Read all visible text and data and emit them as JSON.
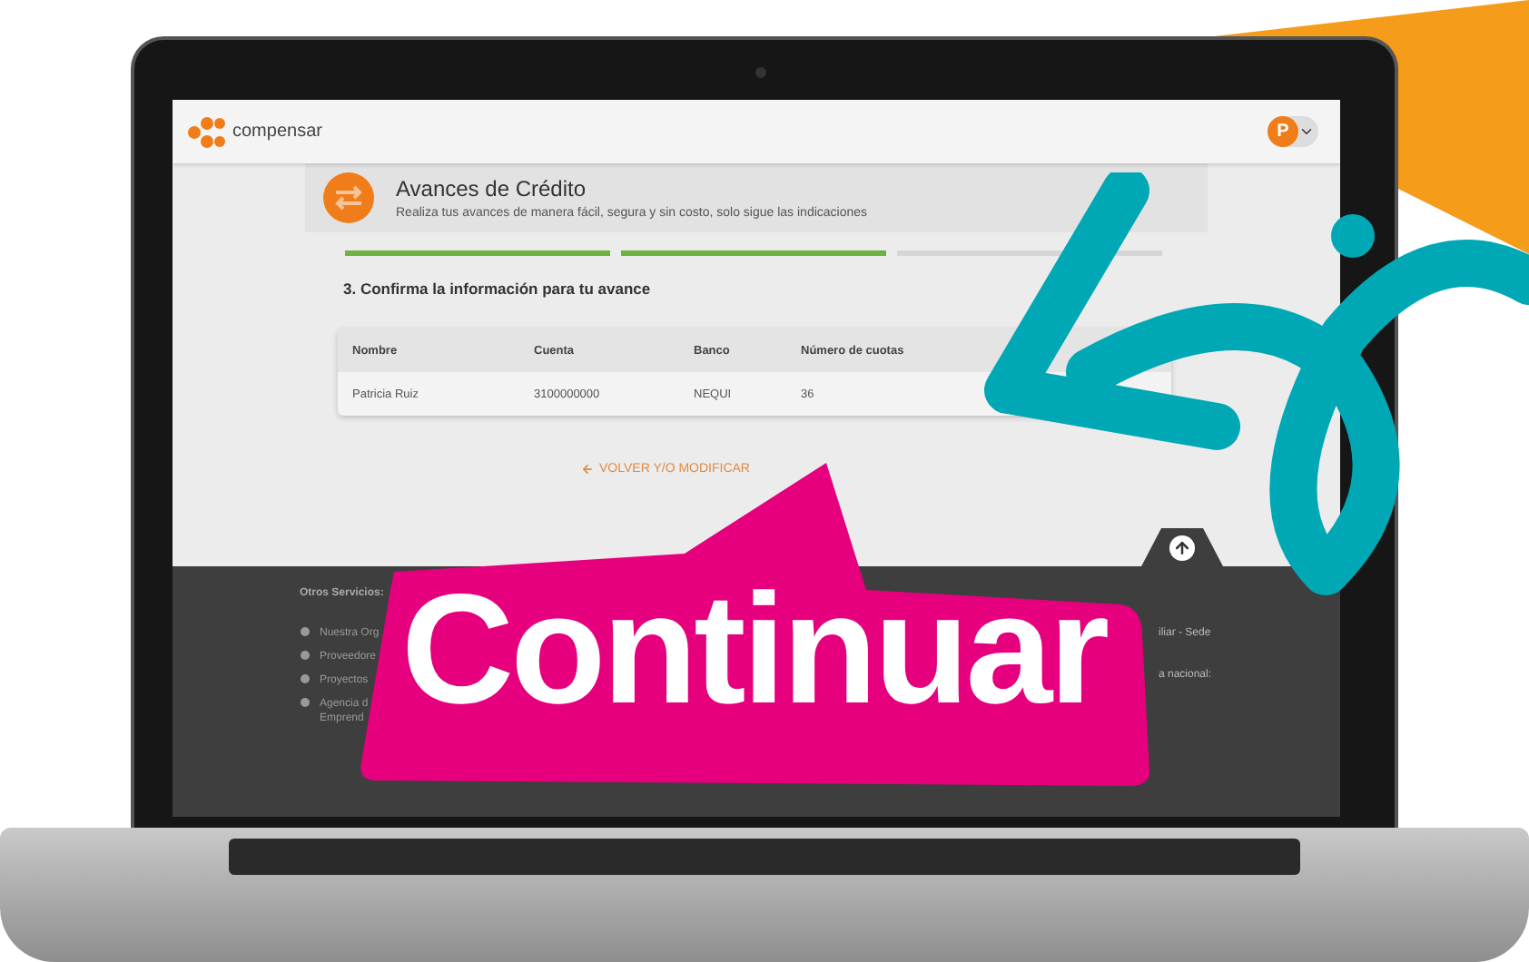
{
  "header": {
    "logo": "compensar",
    "avatar": "P"
  },
  "banner": {
    "title": "Avances de Crédito",
    "subtitle": "Realiza tus avances de manera fácil, segura y sin costo, solo sigue las indicaciones"
  },
  "steps": [
    {
      "done": true
    },
    {
      "done": true
    },
    {
      "done": false
    }
  ],
  "step_title": "3. Confirma la información para tu avance",
  "table": {
    "columns": [
      "Nombre",
      "Cuenta",
      "Banco",
      "Número de cuotas"
    ],
    "rows": [
      [
        "Patricia Ruiz",
        "3100000000",
        "NEQUI",
        "36"
      ]
    ]
  },
  "back_link": "VOLVER Y/O MODIFICAR",
  "footer": {
    "heading": "Otros Servicios:",
    "links": [
      [
        "Nuestra Org"
      ],
      [
        "Proveedore"
      ],
      [
        "Proyectos"
      ],
      [
        "Agencia d",
        "Emprend"
      ]
    ],
    "right": [
      "iliar - Sede",
      "a nacional:"
    ]
  },
  "callout": "Continuar"
}
